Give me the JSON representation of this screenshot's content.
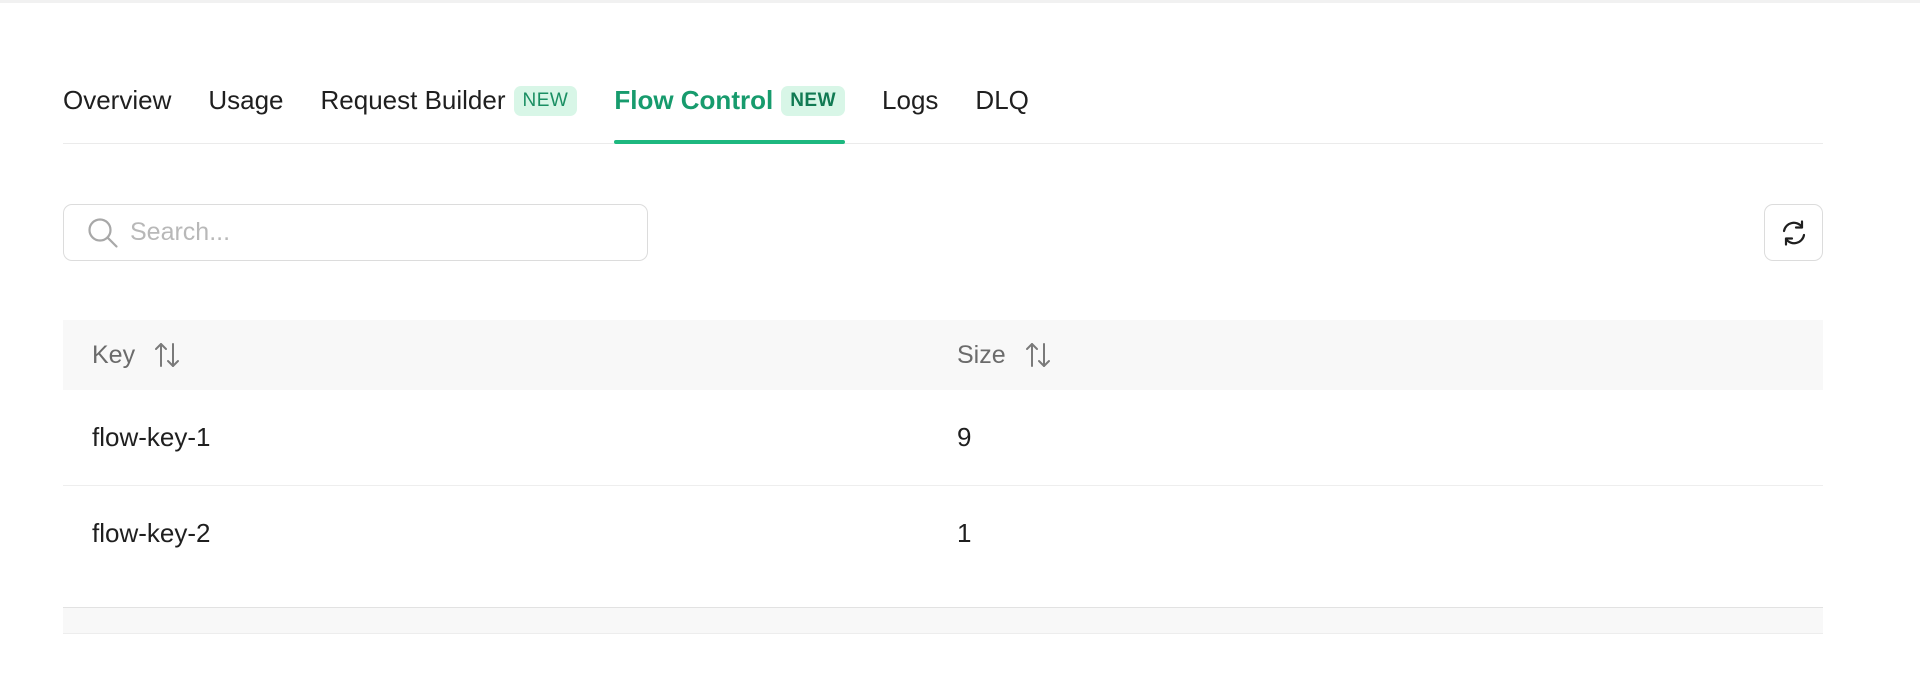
{
  "tabs": [
    {
      "label": "Overview",
      "badge": null,
      "active": false
    },
    {
      "label": "Usage",
      "badge": null,
      "active": false
    },
    {
      "label": "Request Builder",
      "badge": "NEW",
      "active": false
    },
    {
      "label": "Flow Control",
      "badge": "NEW",
      "active": true
    },
    {
      "label": "Logs",
      "badge": null,
      "active": false
    },
    {
      "label": "DLQ",
      "badge": null,
      "active": false
    }
  ],
  "search": {
    "placeholder": "Search...",
    "value": "",
    "icon": "search-icon"
  },
  "refresh": {
    "icon": "refresh-icon"
  },
  "table": {
    "columns": [
      {
        "label": "Key",
        "sort_icon": "sort-icon"
      },
      {
        "label": "Size",
        "sort_icon": "sort-icon"
      }
    ],
    "rows": [
      {
        "key": "flow-key-1",
        "size": "9"
      },
      {
        "key": "flow-key-2",
        "size": "1"
      }
    ]
  },
  "colors": {
    "accent": "#179b6d",
    "badge_bg": "#d8f6e7",
    "header_bg": "#f8f8f8"
  }
}
